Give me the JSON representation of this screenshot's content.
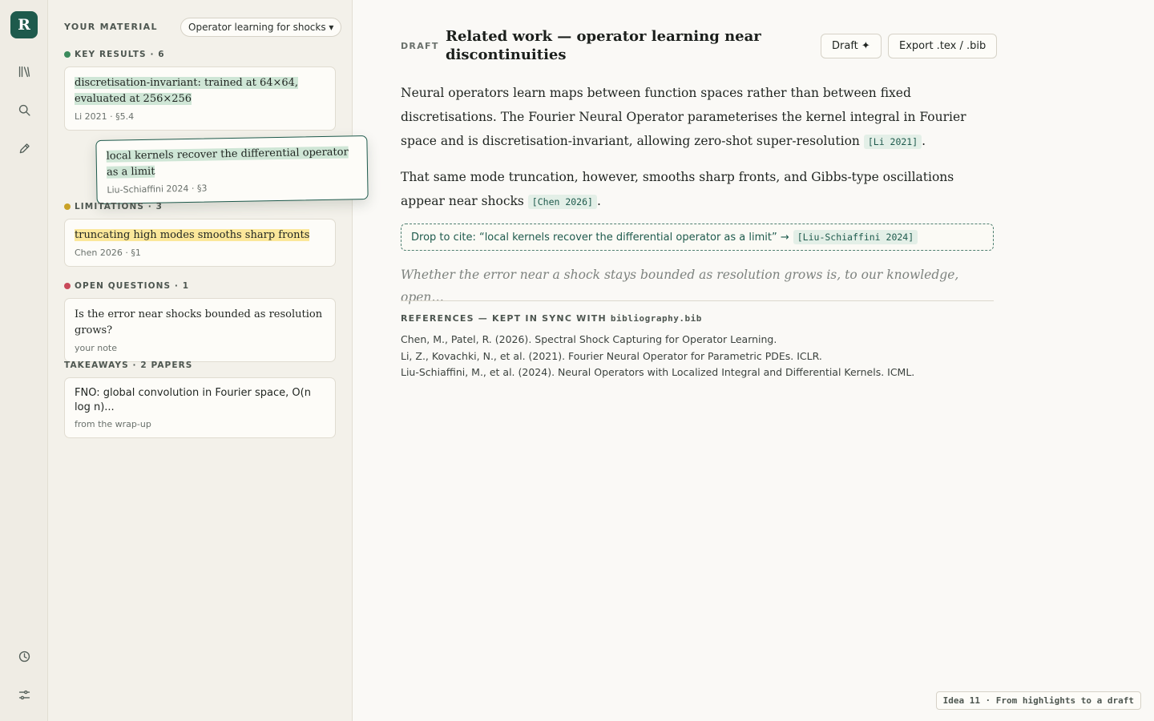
{
  "rail": {
    "logo": "R",
    "icons": [
      "library-icon",
      "search-icon",
      "pencil-icon",
      "history-icon",
      "settings-sliders-icon"
    ]
  },
  "material": {
    "title": "YOUR MATERIAL",
    "topic": "Operator learning for shocks ▾",
    "sections": {
      "key_results": {
        "label": "KEY RESULTS · 6",
        "color": "#3b8a5c"
      },
      "limitations": {
        "label": "LIMITATIONS · 3",
        "color": "#c9a227"
      },
      "open_questions": {
        "label": "OPEN QUESTIONS · 1",
        "color": "#c94a5a"
      },
      "takeaways": {
        "label": "TAKEAWAYS · 2 PAPERS"
      }
    },
    "cards": {
      "key1": {
        "text": "discretisation-invariant: trained at 64×64, evaluated at 256×256",
        "meta": "Li 2021 · §5.4"
      },
      "dragging": {
        "text": "local kernels recover the differential operator as a limit",
        "meta": "Liu-Schiaffini 2024 · §3"
      },
      "lim1": {
        "text": "truncating high modes smooths sharp fronts",
        "meta": "Chen 2026 · §1"
      },
      "q1": {
        "text": "Is the error near shocks bounded as resolution grows?",
        "meta": "your note"
      },
      "take1": {
        "text": "FNO: global convolution in Fourier space, O(n log n)...",
        "meta": "from the wrap-up"
      }
    }
  },
  "draft": {
    "label": "DRAFT",
    "title": "Related work — operator learning near discontinuities",
    "draft_button": "Draft ✦",
    "export_button": "Export .tex / .bib",
    "para1": {
      "text": "Neural operators learn maps between function spaces rather than between fixed discretisations. The Fourier Neural Operator parameterises the kernel integral in Fourier space and is discretisation-invariant, allowing zero-shot super-resolution ",
      "cite": "[Li 2021]",
      "end": "."
    },
    "para2": {
      "text": "That same mode truncation, however, smooths sharp fronts, and Gibbs-type oscillations appear near shocks ",
      "cite": "[Chen 2026]",
      "end": "."
    },
    "dropzone": {
      "text": "Drop to cite: “local kernels recover the differential operator as a limit” →",
      "cite": "[Liu-Schiaffini 2024]"
    },
    "ghost_text": "Whether the error near a shock stays bounded as resolution grows is, to our knowledge, open…",
    "references": {
      "title": "REFERENCES — KEPT IN SYNC WITH ",
      "file": "bibliography.bib",
      "items": [
        "Chen, M., Patel, R. (2026). Spectral Shock Capturing for Operator Learning.",
        "Li, Z., Kovachki, N., et al. (2021). Fourier Neural Operator for Parametric PDEs. ICLR.",
        "Liu-Schiaffini, M., et al. (2024). Neural Operators with Localized Integral and Differential Kernels. ICML."
      ]
    }
  },
  "footer": {
    "tag": "Idea 11 · From highlights to a draft"
  }
}
